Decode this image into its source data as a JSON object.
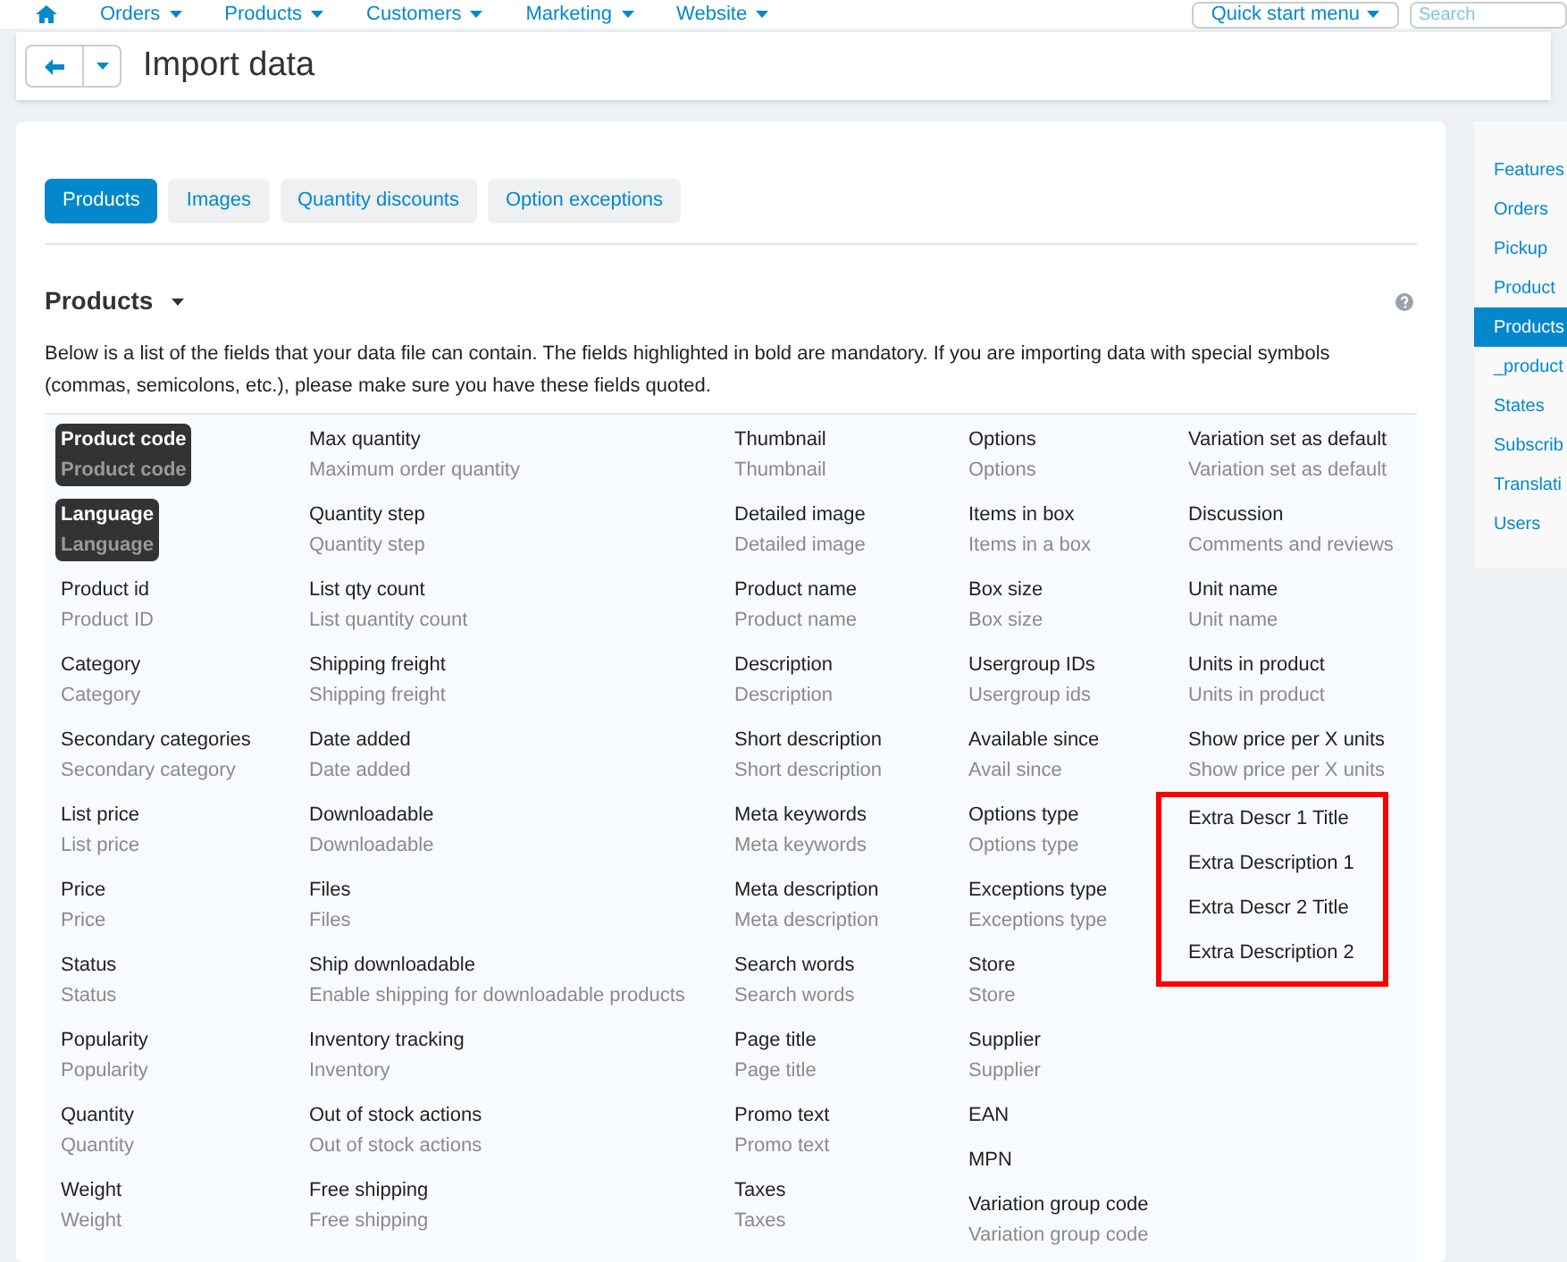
{
  "top_nav": {
    "items": [
      "Orders",
      "Products",
      "Customers",
      "Marketing",
      "Website"
    ],
    "quick_start": "Quick start menu",
    "search": {
      "placeholder": "Search"
    }
  },
  "header": {
    "title": "Import data"
  },
  "tabs": [
    {
      "label": "Products",
      "selected": true
    },
    {
      "label": "Images",
      "selected": false
    },
    {
      "label": "Quantity discounts",
      "selected": false
    },
    {
      "label": "Option exceptions",
      "selected": false
    }
  ],
  "section": {
    "title": "Products",
    "description": "Below is a list of the fields that your data file can contain. The fields highlighted in bold are mandatory. If you are importing data with special symbols (commas, semicolons, etc.), please make sure you have these fields quoted."
  },
  "columns": [
    {
      "fields": [
        {
          "name": "Product code",
          "description": "Product code",
          "mandatory": true
        },
        {
          "name": "Language",
          "description": "Language",
          "mandatory": true
        },
        {
          "name": "Product id",
          "description": "Product ID",
          "mandatory": false
        },
        {
          "name": "Category",
          "description": "Category",
          "mandatory": false
        },
        {
          "name": "Secondary categories",
          "description": "Secondary category",
          "mandatory": false
        },
        {
          "name": "List price",
          "description": "List price",
          "mandatory": false
        },
        {
          "name": "Price",
          "description": "Price",
          "mandatory": false
        },
        {
          "name": "Status",
          "description": "Status",
          "mandatory": false
        },
        {
          "name": "Popularity",
          "description": "Popularity",
          "mandatory": false
        },
        {
          "name": "Quantity",
          "description": "Quantity",
          "mandatory": false
        },
        {
          "name": "Weight",
          "description": "Weight",
          "mandatory": false
        }
      ]
    },
    {
      "fields": [
        {
          "name": "Max quantity",
          "description": "Maximum order quantity",
          "mandatory": false
        },
        {
          "name": "Quantity step",
          "description": "Quantity step",
          "mandatory": false
        },
        {
          "name": "List qty count",
          "description": "List quantity count",
          "mandatory": false
        },
        {
          "name": "Shipping freight",
          "description": "Shipping freight",
          "mandatory": false
        },
        {
          "name": "Date added",
          "description": "Date added",
          "mandatory": false
        },
        {
          "name": "Downloadable",
          "description": "Downloadable",
          "mandatory": false
        },
        {
          "name": "Files",
          "description": "Files",
          "mandatory": false
        },
        {
          "name": "Ship downloadable",
          "description": "Enable shipping for downloadable products",
          "mandatory": false
        },
        {
          "name": "Inventory tracking",
          "description": "Inventory",
          "mandatory": false
        },
        {
          "name": "Out of stock actions",
          "description": "Out of stock actions",
          "mandatory": false
        },
        {
          "name": "Free shipping",
          "description": "Free shipping",
          "mandatory": false
        }
      ]
    },
    {
      "fields": [
        {
          "name": "Thumbnail",
          "description": "Thumbnail",
          "mandatory": false
        },
        {
          "name": "Detailed image",
          "description": "Detailed image",
          "mandatory": false
        },
        {
          "name": "Product name",
          "description": "Product name",
          "mandatory": false
        },
        {
          "name": "Description",
          "description": "Description",
          "mandatory": false
        },
        {
          "name": "Short description",
          "description": "Short description",
          "mandatory": false
        },
        {
          "name": "Meta keywords",
          "description": "Meta keywords",
          "mandatory": false
        },
        {
          "name": "Meta description",
          "description": "Meta description",
          "mandatory": false
        },
        {
          "name": "Search words",
          "description": "Search words",
          "mandatory": false
        },
        {
          "name": "Page title",
          "description": "Page title",
          "mandatory": false
        },
        {
          "name": "Promo text",
          "description": "Promo text",
          "mandatory": false
        },
        {
          "name": "Taxes",
          "description": "Taxes",
          "mandatory": false
        }
      ]
    },
    {
      "fields": [
        {
          "name": "Options",
          "description": "Options",
          "mandatory": false
        },
        {
          "name": "Items in box",
          "description": "Items in a box",
          "mandatory": false
        },
        {
          "name": "Box size",
          "description": "Box size",
          "mandatory": false
        },
        {
          "name": "Usergroup IDs",
          "description": "Usergroup ids",
          "mandatory": false
        },
        {
          "name": "Available since",
          "description": "Avail since",
          "mandatory": false
        },
        {
          "name": "Options type",
          "description": "Options type",
          "mandatory": false
        },
        {
          "name": "Exceptions type",
          "description": "Exceptions type",
          "mandatory": false
        },
        {
          "name": "Store",
          "description": "Store",
          "mandatory": false
        },
        {
          "name": "Supplier",
          "description": "Supplier",
          "mandatory": false
        },
        {
          "name": "EAN",
          "mandatory": false
        },
        {
          "name": "MPN",
          "mandatory": false
        },
        {
          "name": "Variation group code",
          "description": "Variation group code",
          "mandatory": false
        }
      ]
    },
    {
      "fields": [
        {
          "name": "Variation set as default",
          "description": "Variation set as default",
          "mandatory": false
        },
        {
          "name": "Discussion",
          "description": "Comments and reviews",
          "mandatory": false
        },
        {
          "name": "Unit name",
          "description": "Unit name",
          "mandatory": false
        },
        {
          "name": "Units in product",
          "description": "Units in product",
          "mandatory": false
        },
        {
          "name": "Show price per X units",
          "description": "Show price per X units",
          "mandatory": false
        }
      ],
      "marked_fields": [
        {
          "name": "Extra Descr 1 Title",
          "mandatory": false
        },
        {
          "name": "Extra Description 1",
          "mandatory": false
        },
        {
          "name": "Extra Descr 2 Title",
          "mandatory": false
        },
        {
          "name": "Extra Description 2",
          "mandatory": false
        }
      ]
    }
  ],
  "sidebar": {
    "items": [
      {
        "label": "Features",
        "selected": false
      },
      {
        "label": "Orders",
        "selected": false
      },
      {
        "label": "Pickup",
        "selected": false
      },
      {
        "label": "Product",
        "selected": false
      },
      {
        "label": "Products",
        "selected": true
      },
      {
        "label": "_product",
        "selected": false
      },
      {
        "label": "States",
        "selected": false
      },
      {
        "label": "Subscrib",
        "selected": false
      },
      {
        "label": "Translati",
        "selected": false
      },
      {
        "label": "Users",
        "selected": false
      }
    ]
  }
}
